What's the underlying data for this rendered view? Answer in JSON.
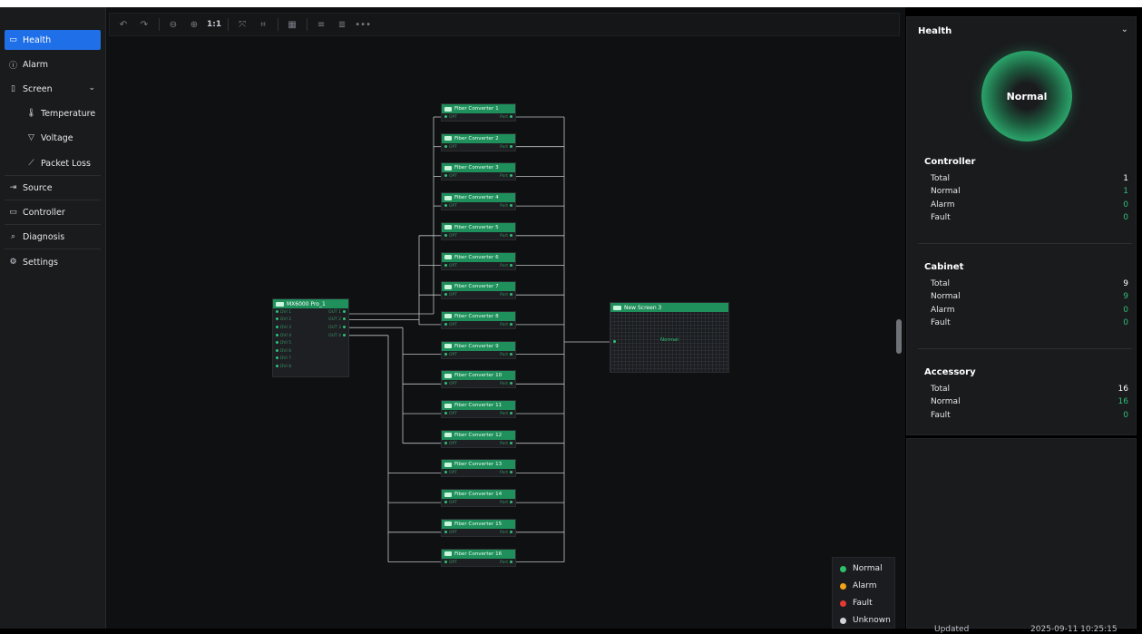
{
  "sidebar": {
    "items": [
      {
        "label": "Health",
        "icon": "health-icon",
        "active": true
      },
      {
        "label": "Alarm",
        "icon": "alarm-icon"
      },
      {
        "label": "Screen",
        "icon": "screen-icon"
      },
      {
        "label": "Temperature",
        "icon": "thermometer-icon"
      },
      {
        "label": "Voltage",
        "icon": "voltage-icon"
      },
      {
        "label": "Packet Loss",
        "icon": "packet-loss-icon"
      },
      {
        "label": "Source",
        "icon": "source-icon"
      },
      {
        "label": "Controller",
        "icon": "controller-icon"
      },
      {
        "label": "Diagnosis",
        "icon": "diagnosis-icon"
      },
      {
        "label": "Settings",
        "icon": "settings-icon"
      }
    ]
  },
  "toolbar": {
    "zoom_reset_label": "1:1"
  },
  "topology": {
    "controller": {
      "name": "MX6000 Pro_1",
      "inputs": [
        "DVI 1",
        "DVI 2",
        "DVI 3",
        "DVI 4",
        "DVI 5",
        "DVI 6",
        "DVI 7",
        "DVI 8"
      ],
      "outputs": [
        "OUT 1",
        "OUT 2",
        "OUT 3",
        "OUT 4"
      ]
    },
    "port_in_label": "OPT",
    "port_out_label": "Port",
    "converters": [
      "Fiber Converter 1",
      "Fiber Converter 2",
      "Fiber Converter 3",
      "Fiber Converter 4",
      "Fiber Converter 5",
      "Fiber Converter 6",
      "Fiber Converter 7",
      "Fiber Converter 8",
      "Fiber Converter 9",
      "Fiber Converter 10",
      "Fiber Converter 11",
      "Fiber Converter 12",
      "Fiber Converter 13",
      "Fiber Converter 14",
      "Fiber Converter 15",
      "Fiber Converter 16"
    ],
    "screen": {
      "name": "New Screen 3",
      "status": "Normal"
    }
  },
  "legend": [
    {
      "label": "Normal",
      "color": "#2fbf6a"
    },
    {
      "label": "Alarm",
      "color": "#f0a21b"
    },
    {
      "label": "Fault",
      "color": "#e53935"
    },
    {
      "label": "Unknown",
      "color": "#cfd3d8"
    }
  ],
  "health_panel": {
    "title": "Health",
    "status": "Normal",
    "controller": {
      "title": "Controller",
      "total_label": "Total",
      "total": "1",
      "normal_label": "Normal",
      "normal": "1",
      "alarm_label": "Alarm",
      "alarm": "0",
      "fault_label": "Fault",
      "fault": "0"
    },
    "cabinet": {
      "title": "Cabinet",
      "total_label": "Total",
      "total": "9",
      "normal_label": "Normal",
      "normal": "9",
      "alarm_label": "Alarm",
      "alarm": "0",
      "fault_label": "Fault",
      "fault": "0"
    },
    "accessory": {
      "title": "Accessory",
      "total_label": "Total",
      "total": "16",
      "normal_label": "Normal",
      "normal": "16",
      "fault_label": "Fault",
      "fault": "0"
    },
    "updated_label": "Updated",
    "updated_value": "2025-09-11 10:25:15"
  },
  "colors": {
    "accent": "#1f6fe8",
    "node_header": "#1f8f5b",
    "ok": "#2fbf7a"
  }
}
